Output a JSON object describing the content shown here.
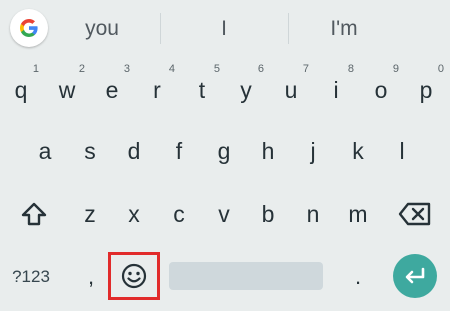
{
  "suggestions": {
    "items": [
      "you",
      "I",
      "I'm"
    ]
  },
  "rows": [
    [
      {
        "key": "q",
        "hint": "1"
      },
      {
        "key": "w",
        "hint": "2"
      },
      {
        "key": "e",
        "hint": "3"
      },
      {
        "key": "r",
        "hint": "4"
      },
      {
        "key": "t",
        "hint": "5"
      },
      {
        "key": "y",
        "hint": "6"
      },
      {
        "key": "u",
        "hint": "7"
      },
      {
        "key": "i",
        "hint": "8"
      },
      {
        "key": "o",
        "hint": "9"
      },
      {
        "key": "p",
        "hint": "0"
      }
    ],
    [
      {
        "key": "a"
      },
      {
        "key": "s"
      },
      {
        "key": "d"
      },
      {
        "key": "f"
      },
      {
        "key": "g"
      },
      {
        "key": "h"
      },
      {
        "key": "j"
      },
      {
        "key": "k"
      },
      {
        "key": "l"
      }
    ],
    [
      {
        "key": "z"
      },
      {
        "key": "x"
      },
      {
        "key": "c"
      },
      {
        "key": "v"
      },
      {
        "key": "b"
      },
      {
        "key": "n"
      },
      {
        "key": "m"
      }
    ]
  ],
  "bottom_row": {
    "symbols": "?123",
    "comma": ",",
    "period": "."
  },
  "icons": {
    "google": "google-g-icon",
    "shift": "shift-icon",
    "backspace": "backspace-icon",
    "emoji": "emoji-icon",
    "enter": "enter-icon"
  },
  "colors": {
    "background": "#e9eded",
    "key_text": "#263238",
    "enter_button": "#3ea99f",
    "highlight_box": "#e12b2b"
  }
}
